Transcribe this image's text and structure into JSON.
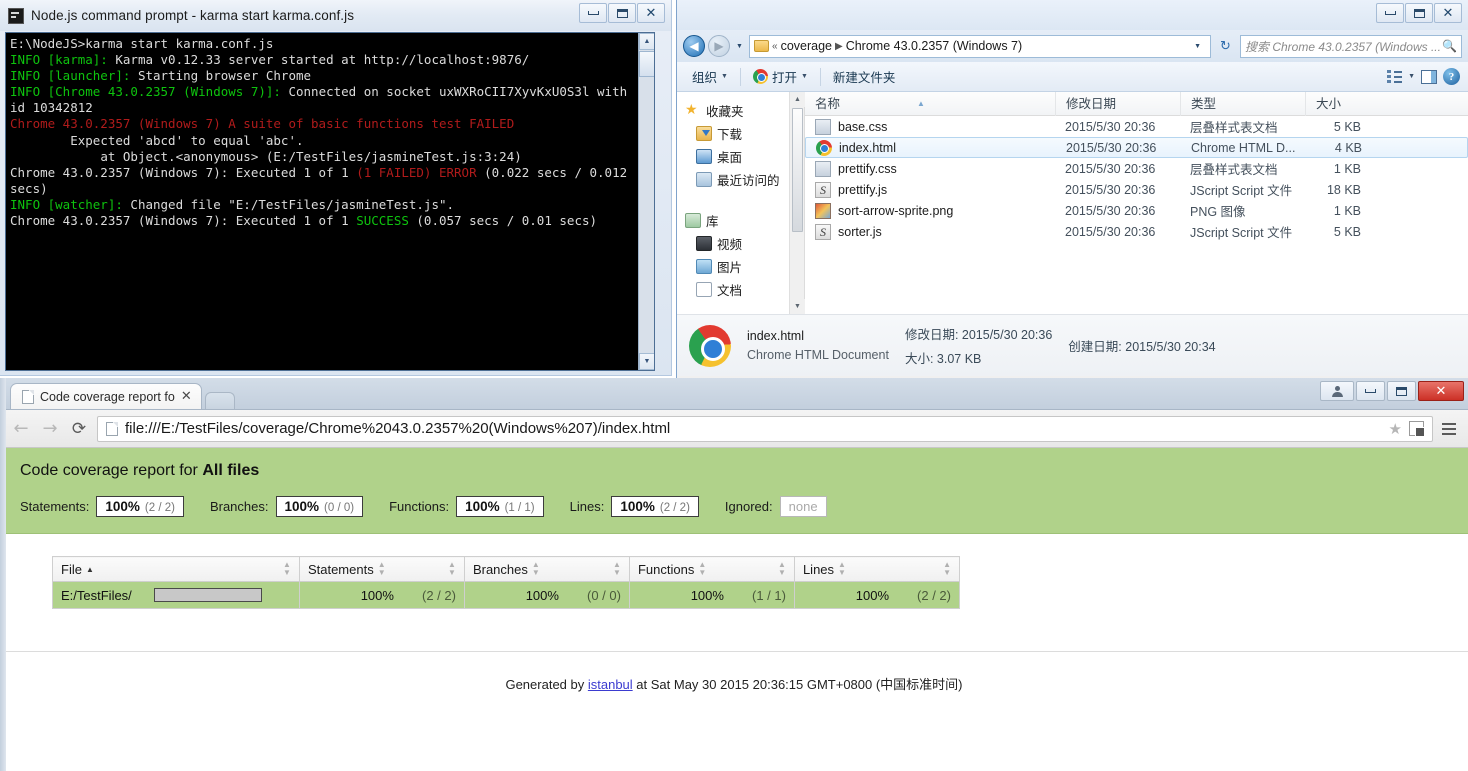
{
  "cmd": {
    "title": "Node.js command prompt - karma  start karma.conf.js",
    "icon": "console-icon",
    "minimize": "–",
    "maximize": "❐",
    "close": "✕",
    "lines": [
      {
        "text": "E:\\NodeJS>karma start karma.conf.js",
        "color": "white"
      },
      {
        "segments": [
          {
            "text": "INFO [karma]:",
            "color": "green"
          },
          {
            "text": " Karma v0.12.33 server started at http://localhost:9876/",
            "color": "white"
          }
        ]
      },
      {
        "segments": [
          {
            "text": "INFO [launcher]:",
            "color": "green"
          },
          {
            "text": " Starting browser Chrome",
            "color": "white"
          }
        ]
      },
      {
        "segments": [
          {
            "text": "INFO [Chrome 43.0.2357 (Windows 7)]:",
            "color": "green"
          },
          {
            "text": " Connected on socket uxWXRoCII7XyvKxU0S3l with id 10342812",
            "color": "white"
          }
        ]
      },
      {
        "text": "Chrome 43.0.2357 (Windows 7) A suite of basic functions test FAILED",
        "color": "red"
      },
      {
        "text": "        Expected 'abcd' to equal 'abc'.",
        "color": "white"
      },
      {
        "text": "            at Object.<anonymous> (E:/TestFiles/jasmineTest.js:3:24)",
        "color": "white"
      },
      {
        "segments": [
          {
            "text": "Chrome 43.0.2357 (Windows 7): Executed 1 of 1 ",
            "color": "white"
          },
          {
            "text": "(1 FAILED) ERROR",
            "color": "red"
          },
          {
            "text": " (0.022 secs / 0.012 secs)",
            "color": "white"
          }
        ]
      },
      {
        "segments": [
          {
            "text": "INFO [watcher]:",
            "color": "green"
          },
          {
            "text": " Changed file \"E:/TestFiles/jasmineTest.js\".",
            "color": "white"
          }
        ]
      },
      {
        "segments": [
          {
            "text": "Chrome 43.0.2357 (Windows 7): Executed 1 of 1 ",
            "color": "white"
          },
          {
            "text": "SUCCESS",
            "color": "green"
          },
          {
            "text": " (0.057 secs / 0.01 secs)",
            "color": "white"
          }
        ]
      }
    ]
  },
  "explorer": {
    "minimize": "–",
    "maximize": "❐",
    "close": "✕",
    "address": {
      "overflow": "«",
      "crumbs": [
        "coverage",
        "Chrome 43.0.2357 (Windows 7)"
      ],
      "separator": "▶",
      "dropdown": "▼",
      "refresh": "↻"
    },
    "search_placeholder": "搜索 Chrome 43.0.2357 (Windows ...",
    "toolbar": {
      "organize": "组织",
      "open": "打开",
      "new_folder": "新建文件夹",
      "caret": "▼"
    },
    "sidebar": [
      {
        "label": "收藏夹",
        "icon": "star-icon",
        "indent": false
      },
      {
        "label": "下载",
        "icon": "downloads-icon",
        "indent": true
      },
      {
        "label": "桌面",
        "icon": "desktop-icon",
        "indent": true
      },
      {
        "label": "最近访问的",
        "icon": "recent-places-icon",
        "indent": true
      },
      {
        "label": "",
        "icon": "spacer",
        "indent": false
      },
      {
        "label": "库",
        "icon": "library-icon",
        "indent": false
      },
      {
        "label": "视频",
        "icon": "video-icon",
        "indent": true
      },
      {
        "label": "图片",
        "icon": "picture-icon",
        "indent": true
      },
      {
        "label": "文档",
        "icon": "document-icon",
        "indent": true
      }
    ],
    "columns": [
      "名称",
      "修改日期",
      "类型",
      "大小"
    ],
    "files": [
      {
        "name": "base.css",
        "date": "2015/5/30 20:36",
        "type": "层叠样式表文档",
        "size": "5 KB",
        "icon": "css-file-icon",
        "selected": false
      },
      {
        "name": "index.html",
        "date": "2015/5/30 20:36",
        "type": "Chrome HTML D...",
        "size": "4 KB",
        "icon": "chrome-file-icon",
        "selected": true
      },
      {
        "name": "prettify.css",
        "date": "2015/5/30 20:36",
        "type": "层叠样式表文档",
        "size": "1 KB",
        "icon": "css-file-icon",
        "selected": false
      },
      {
        "name": "prettify.js",
        "date": "2015/5/30 20:36",
        "type": "JScript Script 文件",
        "size": "18 KB",
        "icon": "js-file-icon",
        "selected": false
      },
      {
        "name": "sort-arrow-sprite.png",
        "date": "2015/5/30 20:36",
        "type": "PNG 图像",
        "size": "1 KB",
        "icon": "png-file-icon",
        "selected": false
      },
      {
        "name": "sorter.js",
        "date": "2015/5/30 20:36",
        "type": "JScript Script 文件",
        "size": "5 KB",
        "icon": "js-file-icon",
        "selected": false
      }
    ],
    "status": {
      "filename": "index.html",
      "filetype": "Chrome HTML Document",
      "modified_label": "修改日期:",
      "modified_value": "2015/5/30 20:36",
      "size_label": "大小:",
      "size_value": "3.07 KB",
      "created_label": "创建日期:",
      "created_value": "2015/5/30 20:34"
    }
  },
  "browser": {
    "tab_title": "Code coverage report fo",
    "tab_close": "✕",
    "back": "←",
    "forward": "→",
    "reload": "⟳",
    "url": "file:///E:/TestFiles/coverage/Chrome%2043.0.2357%20(Windows%207)/index.html",
    "star": "★",
    "minimize": "–",
    "maximize": "❐",
    "close": "✕"
  },
  "report": {
    "title_prefix": "Code coverage report for ",
    "title_target": "All files",
    "summary": [
      {
        "label": "Statements:",
        "pct": "100%",
        "frac": "(2 / 2)",
        "ignored": false
      },
      {
        "label": "Branches:",
        "pct": "100%",
        "frac": "(0 / 0)",
        "ignored": false
      },
      {
        "label": "Functions:",
        "pct": "100%",
        "frac": "(1 / 1)",
        "ignored": false
      },
      {
        "label": "Lines:",
        "pct": "100%",
        "frac": "(2 / 2)",
        "ignored": false
      },
      {
        "label": "Ignored:",
        "pct": "none",
        "frac": "",
        "ignored": true
      }
    ],
    "table": {
      "headers": [
        {
          "label": "File",
          "sorted_asc": true
        },
        {
          "label": "Statements",
          "sorted_asc": false
        },
        {
          "label": "Branches",
          "sorted_asc": false
        },
        {
          "label": "Functions",
          "sorted_asc": false
        },
        {
          "label": "Lines",
          "sorted_asc": false
        }
      ],
      "rows": [
        {
          "file": "E:/TestFiles/",
          "statements_pct": "100%",
          "statements_frac": "(2 / 2)",
          "branches_pct": "100%",
          "branches_frac": "(0 / 0)",
          "functions_pct": "100%",
          "functions_frac": "(1 / 1)",
          "lines_pct": "100%",
          "lines_frac": "(2 / 2)"
        }
      ]
    },
    "footer": {
      "prefix": "Generated by ",
      "link": "istanbul",
      "suffix": " at Sat May 30 2015 20:36:15 GMT+0800 (中国标准时间)"
    },
    "colors": {
      "header_green": "#b0d28a",
      "row_green": "#b0d28a"
    }
  }
}
